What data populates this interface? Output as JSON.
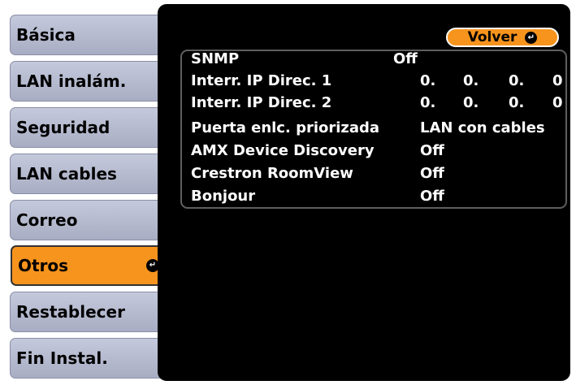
{
  "sidebar": {
    "items": [
      {
        "label": "Básica"
      },
      {
        "label": "LAN inalám."
      },
      {
        "label": "Seguridad"
      },
      {
        "label": "LAN cables"
      },
      {
        "label": "Correo"
      },
      {
        "label": "Otros",
        "selected": true
      },
      {
        "label": "Restablecer"
      },
      {
        "label": "Fin Instal."
      }
    ]
  },
  "panel": {
    "back_label": "Volver",
    "settings": [
      {
        "label": "SNMP",
        "value": "Off"
      },
      {
        "label": "Interr. IP Direc. 1",
        "octets": [
          "0.",
          "0.",
          "0.",
          "0"
        ]
      },
      {
        "label": "Interr. IP Direc. 2",
        "octets": [
          "0.",
          "0.",
          "0.",
          "0"
        ]
      },
      {
        "label": "Puerta enlc. priorizada",
        "value": "LAN con cables"
      },
      {
        "label": "AMX Device Discovery",
        "value": "Off"
      },
      {
        "label": "Crestron RoomView",
        "value": "Off"
      },
      {
        "label": "Bonjour",
        "value": "Off"
      }
    ]
  },
  "icons": {
    "enter": "enter-return-icon"
  },
  "colors": {
    "accent": "#f7941d",
    "panel": "#000000",
    "menu": "#b8bdd0"
  }
}
